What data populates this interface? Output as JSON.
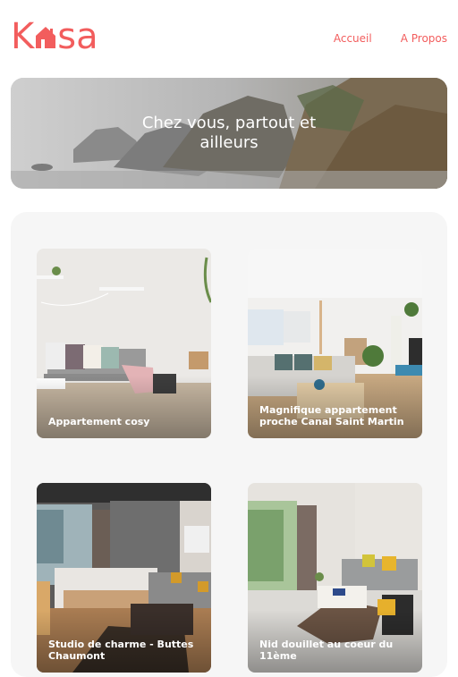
{
  "header": {
    "logo_text_left": "K",
    "logo_text_right": "sa",
    "logo_icon": "house-icon",
    "nav": [
      {
        "label": "Accueil"
      },
      {
        "label": "A Propos"
      }
    ]
  },
  "banner": {
    "title_line1": "Chez vous, partout et",
    "title_line2": "ailleurs"
  },
  "listings": [
    {
      "title": "Appartement cosy"
    },
    {
      "title": "Magnifique appartement proche Canal Saint Martin"
    },
    {
      "title": "Studio de charme - Buttes Chaumont"
    },
    {
      "title": "Nid douillet au coeur du 11ème"
    }
  ],
  "colors": {
    "brand": "#f25d5d",
    "gallery_bg": "#f6f6f6"
  }
}
